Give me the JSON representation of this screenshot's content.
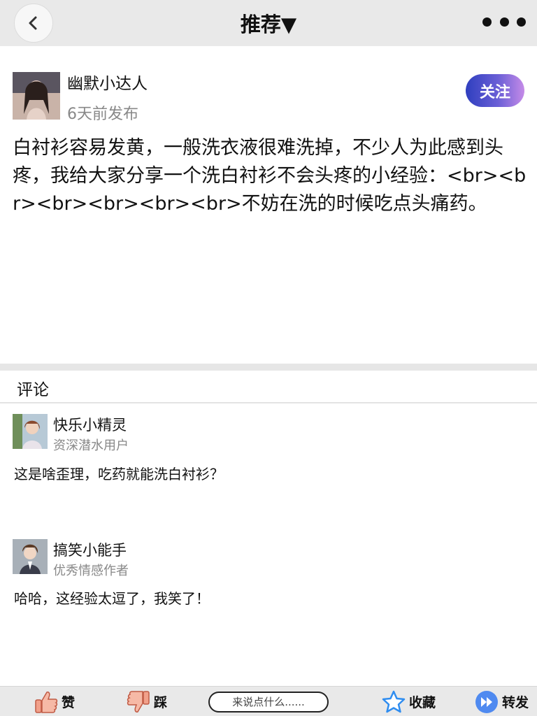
{
  "header": {
    "title": "推荐▼"
  },
  "post": {
    "author": {
      "name": "幽默小达人",
      "time": "6天前发布"
    },
    "follow_label": "关注",
    "content": "白衬衫容易发黄，一般洗衣液很难洗掉，不少人为此感到头疼，我给大家分享一个洗白衬衫不会头疼的小经验：<br><br><br><br><br><br>不妨在洗的时候吃点头痛药。"
  },
  "comments_section": {
    "title": "评论",
    "items": [
      {
        "name": "快乐小精灵",
        "role": "资深潜水用户",
        "text": "这是啥歪理，吃药就能洗白衬衫？"
      },
      {
        "name": "搞笑小能手",
        "role": "优秀情感作者",
        "text": "哈哈，这经验太逗了，我笑了！"
      }
    ]
  },
  "bottom_bar": {
    "like_label": "赞",
    "dislike_label": "踩",
    "comment_placeholder": "来说点什么......",
    "favorite_label": "收藏",
    "share_label": "转发"
  },
  "colors": {
    "follow_gradient_start": "#2f3fbf",
    "follow_gradient_end": "#c58be8",
    "like_icon": "#f1a08a",
    "favorite_icon": "#2f8df0",
    "share_icon": "#4f8af0"
  }
}
